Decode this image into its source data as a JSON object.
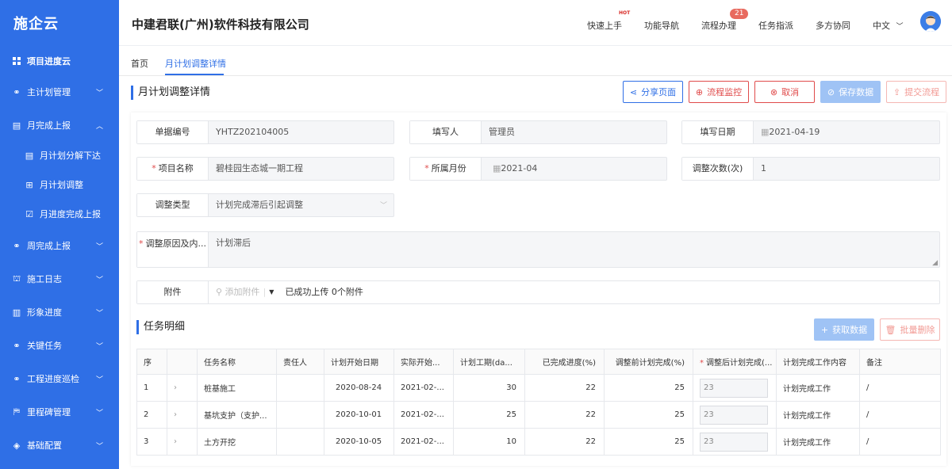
{
  "app": {
    "logo": "施企云",
    "company": "中建君联(广州)软件科技有限公司"
  },
  "topnav": {
    "quick_start": "快速上手",
    "hot": "HOT",
    "func_nav": "功能导航",
    "process": "流程办理",
    "process_badge": "21",
    "task_assign": "任务指派",
    "collab": "多方协同",
    "lang": "中文"
  },
  "sidebar": {
    "items": [
      {
        "label": "项目进度云"
      },
      {
        "label": "主计划管理"
      },
      {
        "label": "月完成上报"
      },
      {
        "label": "月计划分解下达"
      },
      {
        "label": "月计划调整"
      },
      {
        "label": "月进度完成上报"
      },
      {
        "label": "周完成上报"
      },
      {
        "label": "施工日志"
      },
      {
        "label": "形象进度"
      },
      {
        "label": "关键任务"
      },
      {
        "label": "工程进度巡检"
      },
      {
        "label": "里程碑管理"
      },
      {
        "label": "基础配置"
      }
    ]
  },
  "tabs": {
    "home": "首页",
    "detail": "月计划调整详情"
  },
  "page": {
    "title": "月计划调整详情"
  },
  "buttons": {
    "share": "分享页面",
    "monitor": "流程监控",
    "cancel": "取消",
    "save": "保存数据",
    "submit": "提交流程",
    "fetch": "获取数据",
    "batch_delete": "批量删除"
  },
  "form": {
    "doc_no": {
      "label": "单据编号",
      "value": "YHTZ202104005"
    },
    "filler": {
      "label": "填写人",
      "value": "管理员"
    },
    "fill_date": {
      "label": "填写日期",
      "value": "2021-04-19"
    },
    "project": {
      "label": "项目名称",
      "value": "碧桂园生态城一期工程"
    },
    "month": {
      "label": "所属月份",
      "value": "2021-04"
    },
    "adjust_count": {
      "label": "调整次数(次)",
      "value": "1"
    },
    "adjust_type": {
      "label": "调整类型",
      "value": "计划完成滞后引起调整"
    },
    "reason": {
      "label": "调整原因及内...",
      "value": "计划滞后"
    },
    "attachment": {
      "label": "附件",
      "add": "添加附件",
      "status": "已成功上传 0个附件"
    }
  },
  "task": {
    "title": "任务明细"
  },
  "table": {
    "headers": [
      "序",
      "",
      "任务名称",
      "责任人",
      "计划开始日期",
      "实际开始...",
      "计划工期(da...",
      "已完成进度(%)",
      "调整前计划完成(%)",
      "调整后计划完成(...",
      "计划完成工作内容",
      "备注"
    ],
    "rows": [
      {
        "no": "1",
        "name": "桩基施工",
        "owner": "",
        "plan_start": "2020-08-24",
        "actual_start": "2021-02-...",
        "duration": "30",
        "done": "22",
        "before": "25",
        "after": "23",
        "content": "计划完成工作",
        "remark": "/"
      },
      {
        "no": "2",
        "name": "基坑支护（支护...",
        "owner": "",
        "plan_start": "2020-10-01",
        "actual_start": "2021-02-...",
        "duration": "25",
        "done": "22",
        "before": "25",
        "after": "23",
        "content": "计划完成工作",
        "remark": "/"
      },
      {
        "no": "3",
        "name": "土方开挖",
        "owner": "",
        "plan_start": "2020-10-05",
        "actual_start": "2021-02-...",
        "duration": "10",
        "done": "22",
        "before": "25",
        "after": "23",
        "content": "计划完成工作",
        "remark": "/"
      }
    ]
  },
  "colors": {
    "primary": "#2f6fe6",
    "danger": "#e04b4b"
  }
}
